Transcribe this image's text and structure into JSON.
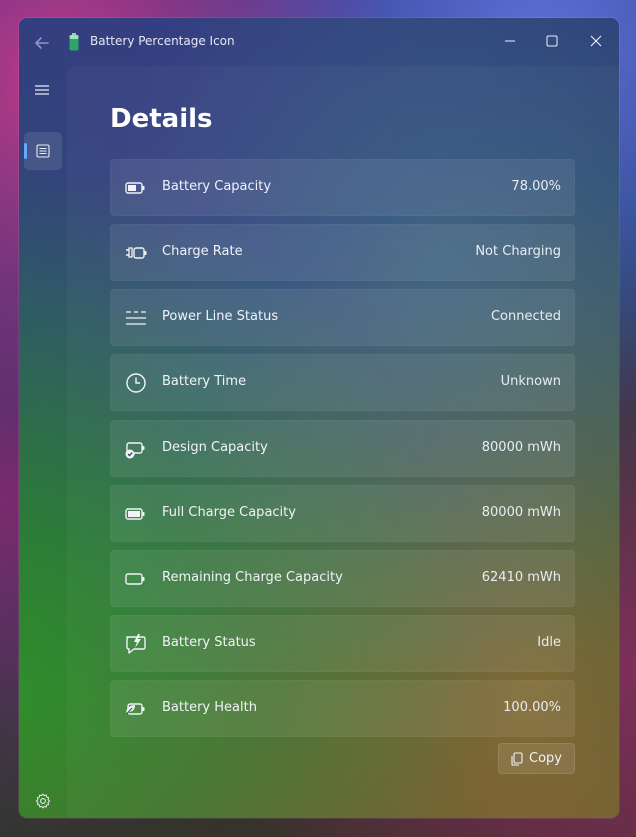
{
  "window": {
    "title": "Battery Percentage Icon"
  },
  "page": {
    "title": "Details"
  },
  "details": [
    {
      "label": "Battery Capacity",
      "value": "78.00%",
      "icon": "battery-icon"
    },
    {
      "label": "Charge Rate",
      "value": "Not Charging",
      "icon": "plug-battery-icon"
    },
    {
      "label": "Power Line Status",
      "value": "Connected",
      "icon": "power-line-icon"
    },
    {
      "label": "Battery Time",
      "value": "Unknown",
      "icon": "clock-icon"
    },
    {
      "label": "Design Capacity",
      "value": "80000 mWh",
      "icon": "battery-check-icon"
    },
    {
      "label": "Full Charge Capacity",
      "value": "80000 mWh",
      "icon": "battery-full-icon"
    },
    {
      "label": "Remaining Charge Capacity",
      "value": "62410 mWh",
      "icon": "battery-empty-icon"
    },
    {
      "label": "Battery Status",
      "value": "Idle",
      "icon": "chat-bolt-icon"
    },
    {
      "label": "Battery Health",
      "value": "100.00%",
      "icon": "battery-leaf-icon"
    }
  ],
  "actions": {
    "copy_label": "Copy"
  },
  "colors": {
    "accent": "#64a9ff",
    "text": "#f1f3f8"
  }
}
